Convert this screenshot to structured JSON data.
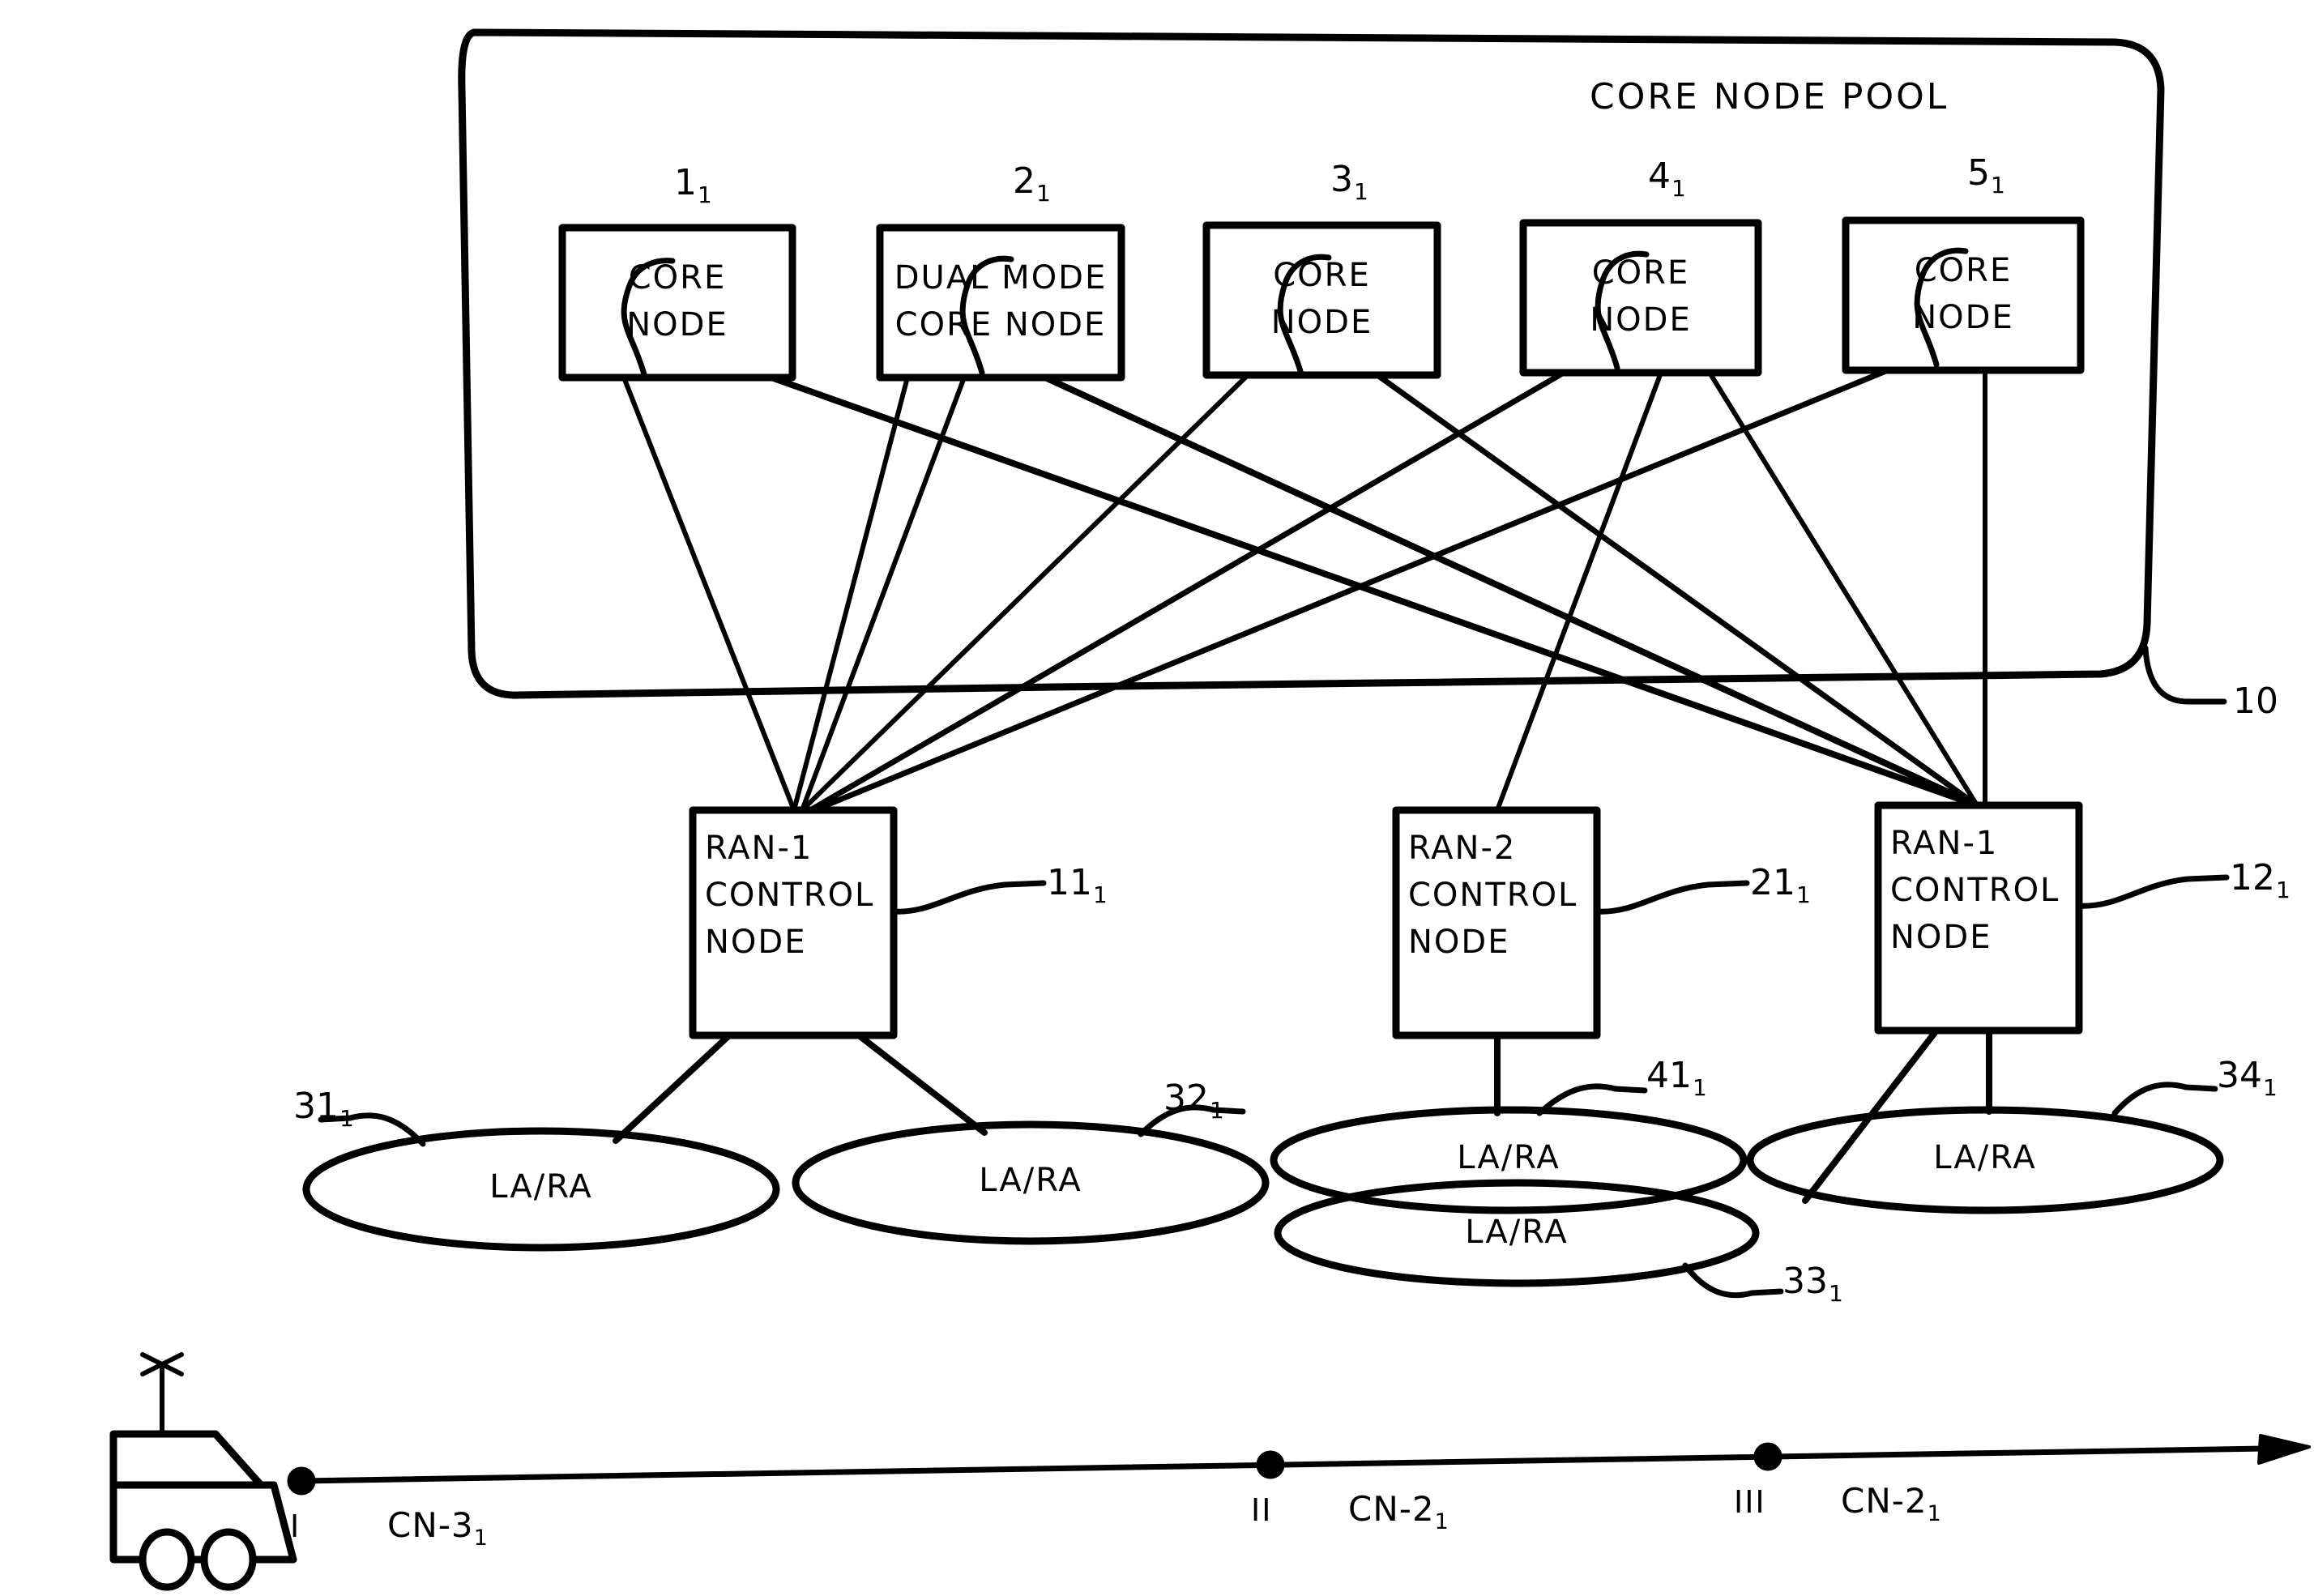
{
  "figure": {
    "title": "Core node pool network architecture diagram",
    "pool": {
      "title": "CORE NODE POOL",
      "ref": "10"
    },
    "core_nodes": [
      {
        "id": "core-node-1",
        "label": "CORE\nNODE",
        "line1": "CORE",
        "line2": "NODE",
        "ref_num": "1",
        "ref_sub": "1"
      },
      {
        "id": "core-node-2",
        "label": "DUAL MODE\nCORE NODE",
        "line1": "DUAL MODE",
        "line2": "CORE NODE",
        "ref_num": "2",
        "ref_sub": "1"
      },
      {
        "id": "core-node-3",
        "label": "CORE\nNODE",
        "line1": "CORE",
        "line2": "NODE",
        "ref_num": "3",
        "ref_sub": "1"
      },
      {
        "id": "core-node-4",
        "label": "CORE\nNODE",
        "line1": "CORE",
        "line2": "NODE",
        "ref_num": "4",
        "ref_sub": "1"
      },
      {
        "id": "core-node-5",
        "label": "CORE\nNODE",
        "line1": "CORE",
        "line2": "NODE",
        "ref_num": "5",
        "ref_sub": "1"
      }
    ],
    "control_nodes": [
      {
        "id": "ran-control-node-1",
        "line1": "RAN-1",
        "line2": "CONTROL",
        "line3": "NODE",
        "ref_num": "11",
        "ref_sub": "1"
      },
      {
        "id": "ran-control-node-2",
        "line1": "RAN-2",
        "line2": "CONTROL",
        "line3": "NODE",
        "ref_num": "21",
        "ref_sub": "1"
      },
      {
        "id": "ran-control-node-3",
        "line1": "RAN-1",
        "line2": "CONTROL",
        "line3": "NODE",
        "ref_num": "12",
        "ref_sub": "1"
      }
    ],
    "areas": [
      {
        "id": "la-ra-31",
        "label": "LA/RA",
        "ref_num": "31",
        "ref_sub": "1"
      },
      {
        "id": "la-ra-32",
        "label": "LA/RA",
        "ref_num": "32",
        "ref_sub": "1"
      },
      {
        "id": "la-ra-41",
        "label": "LA/RA",
        "ref_num": "41",
        "ref_sub": "1"
      },
      {
        "id": "la-ra-33",
        "label": "LA/RA",
        "ref_num": "33",
        "ref_sub": "1"
      },
      {
        "id": "la-ra-34",
        "label": "LA/RA",
        "ref_num": "34",
        "ref_sub": "1"
      }
    ],
    "timeline": {
      "markers": [
        {
          "id": "timeline-marker-1",
          "roman": "I",
          "cn_prefix": "CN-3",
          "cn_sub": "1"
        },
        {
          "id": "timeline-marker-2",
          "roman": "II",
          "cn_prefix": "CN-2",
          "cn_sub": "1"
        },
        {
          "id": "timeline-marker-3",
          "roman": "III",
          "cn_prefix": "CN-2",
          "cn_sub": "1"
        }
      ],
      "vehicle_icon": "vehicle-with-antenna-icon"
    },
    "colors": {
      "ink": "#000000",
      "paper": "#ffffff"
    }
  }
}
